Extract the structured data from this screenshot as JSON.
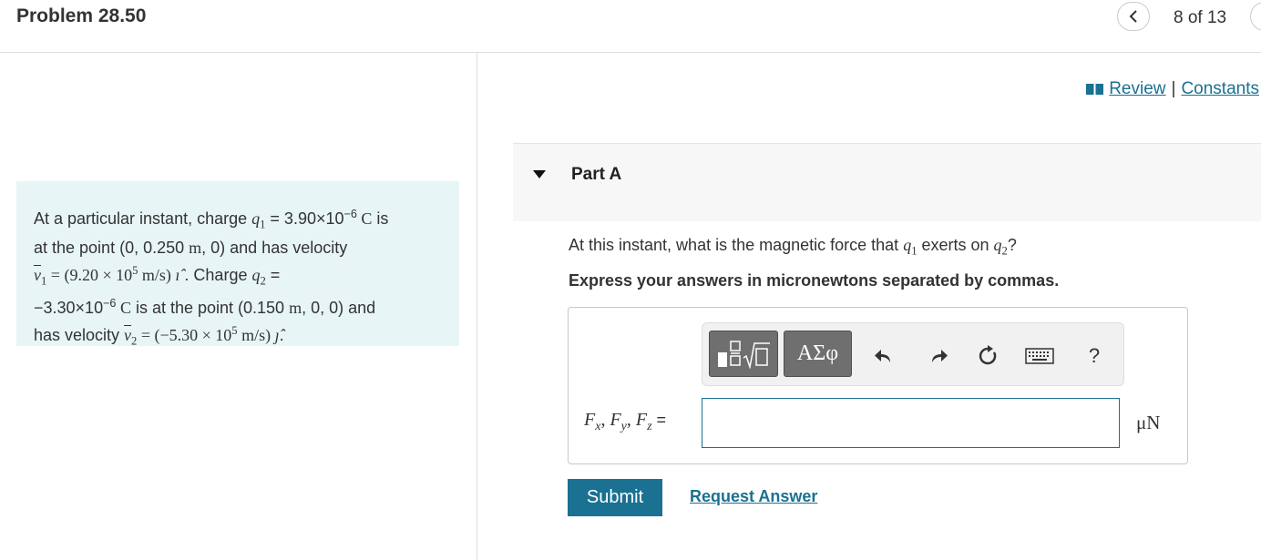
{
  "header": {
    "title": "Problem 28.50",
    "counter": "8 of 13"
  },
  "problem": {
    "line1_a": "At a particular instant, charge ",
    "q1": "q",
    "q1_sub": "1",
    "line1_b": " = 3.90×10",
    "line1_exp": "−6",
    "line1_c": " C",
    "line1_d": " is",
    "line2_a": "at the point (0, 0.250 ",
    "line2_m": "m",
    "line2_b": ", 0) and has velocity",
    "v1": "v",
    "v1_sub": "1",
    "v1_eq": " = (9.20 × 10",
    "v1_exp": "5",
    "v1_unit": " m/s) ",
    "v1_hat": "ı̂",
    "line3_b": " . Charge ",
    "q2": "q",
    "q2_sub": "2",
    "line3_c": " =",
    "line4_a": "−3.30×10",
    "line4_exp": "−6",
    "line4_c": " C",
    "line4_b": " is at the point (0.150 ",
    "line4_m": "m",
    "line4_d": ", 0, 0) and",
    "line5_a": "has velocity ",
    "v2": "v",
    "v2_sub": "2",
    "v2_eq": " = (−5.30 × 10",
    "v2_exp": "5",
    "v2_unit": " m/s) ",
    "v2_hat": "ȷ̂",
    "line5_end": "."
  },
  "links": {
    "review": "Review",
    "separator": "|",
    "constants": "Constants"
  },
  "part": {
    "label": "Part A",
    "question_a": "At this instant, what is the magnetic force that ",
    "question_q1": "q",
    "question_q1_sub": "1",
    "question_b": " exerts on ",
    "question_q2": "q",
    "question_q2_sub": "2",
    "question_c": "?",
    "instruction": "Express your answers in micronewtons separated by commas."
  },
  "answer": {
    "symbols_label": "ΑΣφ",
    "help_label": "?",
    "eq_f": "F",
    "eq_x": "x",
    "eq_y": "y",
    "eq_z": "z",
    "eq_comma": ", ",
    "eq_equals": " =",
    "value": "",
    "unit": "μN",
    "submit": "Submit",
    "request": "Request Answer"
  },
  "colors": {
    "accent": "#1a7191",
    "problem_bg": "#e8f5f6",
    "toolbar_button": "#6f6f6f"
  },
  "icons": [
    "chevron-left-icon",
    "book-icon",
    "caret-down-icon",
    "templates-icon",
    "undo-icon",
    "redo-icon",
    "reset-icon",
    "keyboard-icon",
    "help-icon"
  ]
}
